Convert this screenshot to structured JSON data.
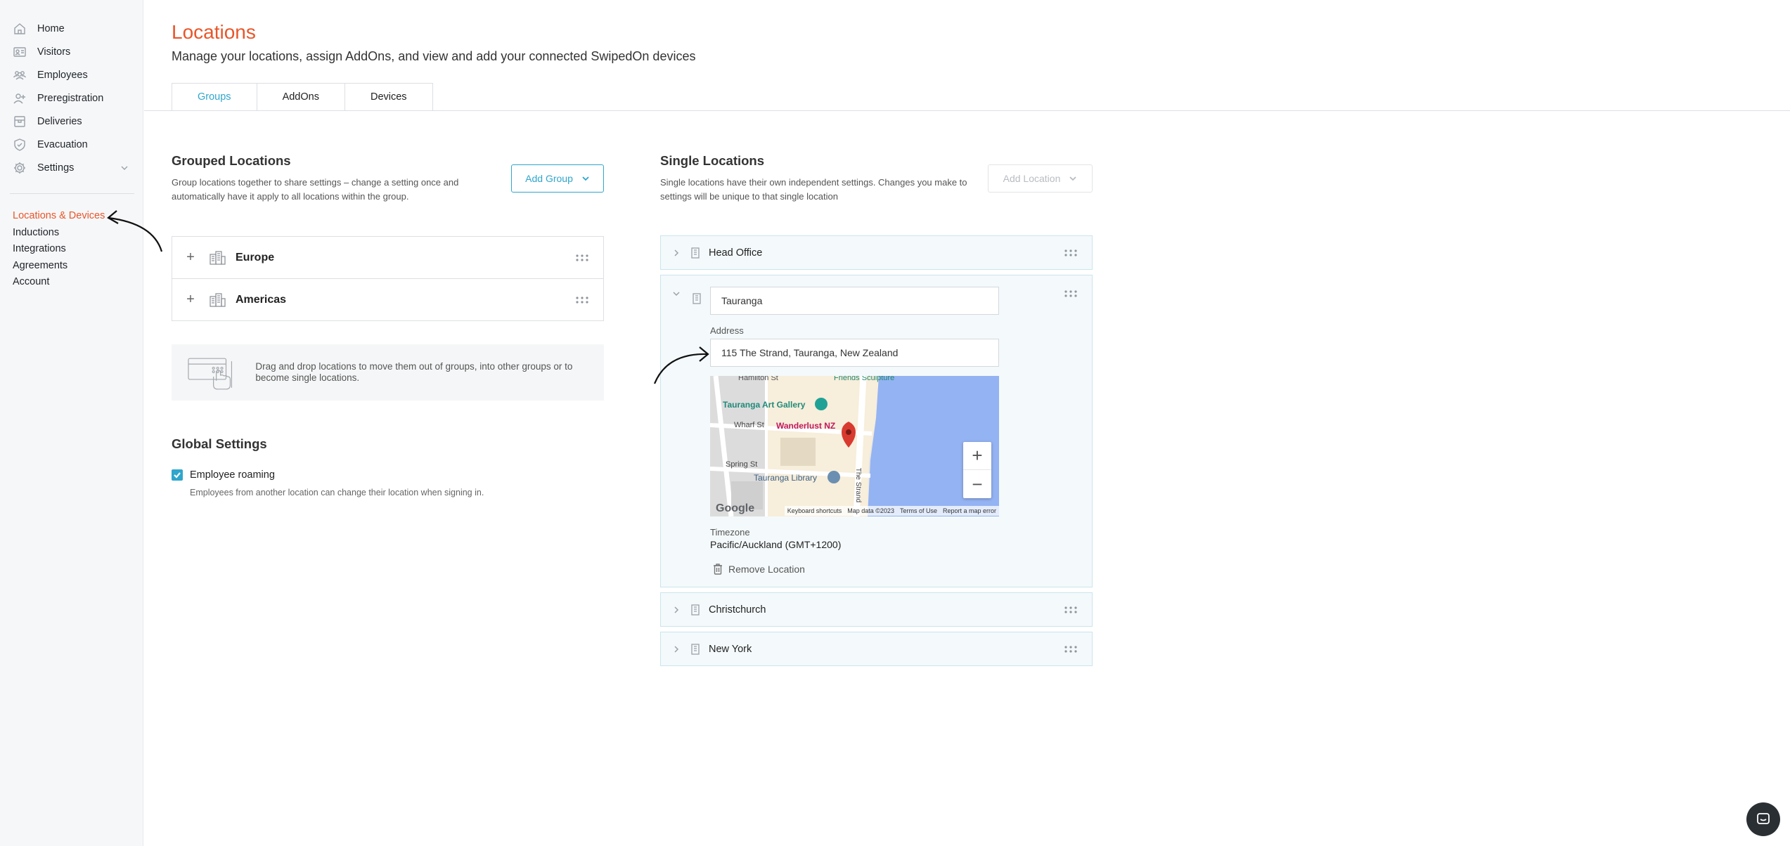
{
  "sidebar": {
    "nav": [
      {
        "label": "Home",
        "icon": "home-icon"
      },
      {
        "label": "Visitors",
        "icon": "visitor-card-icon"
      },
      {
        "label": "Employees",
        "icon": "people-icon"
      },
      {
        "label": "Preregistration",
        "icon": "user-plus-icon"
      },
      {
        "label": "Deliveries",
        "icon": "box-icon"
      },
      {
        "label": "Evacuation",
        "icon": "shield-icon"
      },
      {
        "label": "Settings",
        "icon": "gear-icon"
      }
    ],
    "subnav": [
      "Locations & Devices",
      "Inductions",
      "Integrations",
      "Agreements",
      "Account"
    ],
    "active_subnav": "Locations & Devices"
  },
  "header": {
    "title": "Locations",
    "subtitle": "Manage your locations, assign AddOns, and view and add your connected SwipedOn devices"
  },
  "tabs": [
    {
      "label": "Groups",
      "active": true
    },
    {
      "label": "AddOns",
      "active": false
    },
    {
      "label": "Devices",
      "active": false
    }
  ],
  "grouped": {
    "title": "Grouped Locations",
    "description": "Group locations together to share settings – change a setting once and automatically have it apply to all locations within the group.",
    "add_button": "Add Group",
    "groups": [
      {
        "name": "Europe"
      },
      {
        "name": "Americas"
      }
    ],
    "dragdrop_hint": "Drag and drop locations to move them out of groups, into other groups or to become single locations."
  },
  "global_settings": {
    "title": "Global Settings",
    "employee_roaming": {
      "label": "Employee roaming",
      "checked": true,
      "description": "Employees from another location can change their location when signing in."
    }
  },
  "single": {
    "title": "Single Locations",
    "description": "Single locations have their own independent settings. Changes you make to settings will be unique to that single location",
    "add_button": "Add Location",
    "locations": [
      {
        "name": "Head Office"
      },
      {
        "name": "Christchurch"
      },
      {
        "name": "New York"
      }
    ],
    "expanded": {
      "name": "Tauranga",
      "address_label": "Address",
      "address": "115 The Strand, Tauranga, New Zealand",
      "timezone_label": "Timezone",
      "timezone": "Pacific/Auckland (GMT+1200)",
      "remove_label": "Remove Location",
      "map": {
        "labels": {
          "hamilton": "Hamilton St",
          "gallery": "Tauranga Art Gallery",
          "friends": "Friends Sculpture",
          "wanderlust": "Wanderlust NZ",
          "wharf": "Wharf St",
          "spring": "Spring St",
          "library": "Tauranga Library",
          "strand": "The Strand"
        },
        "footer": [
          "Keyboard shortcuts",
          "Map data ©2023",
          "Terms of Use",
          "Report a map error"
        ],
        "logo": "Google",
        "zoom_in": "+",
        "zoom_out": "−"
      }
    }
  },
  "colors": {
    "accent": "#e8562a",
    "primary": "#2fa6cc"
  }
}
